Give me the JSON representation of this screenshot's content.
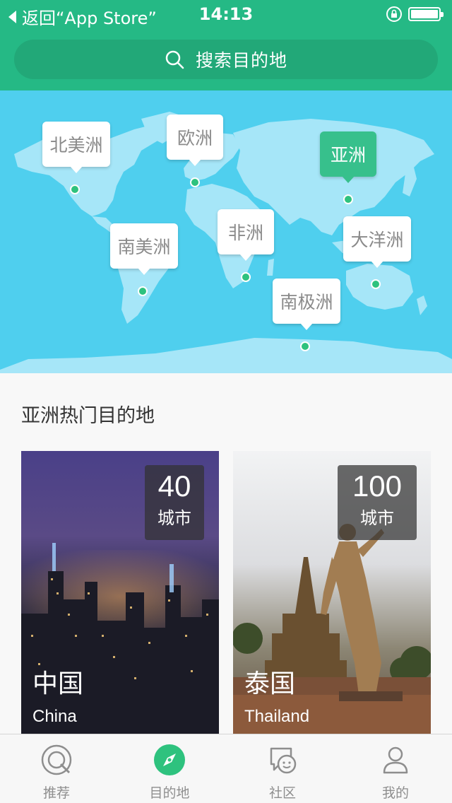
{
  "status_bar": {
    "back_label": "返回“App Store”",
    "time": "14:13"
  },
  "search": {
    "placeholder": "搜索目的地"
  },
  "map": {
    "regions": [
      {
        "id": "north-america",
        "label": "北美洲",
        "active": false
      },
      {
        "id": "europe",
        "label": "欧洲",
        "active": false
      },
      {
        "id": "asia",
        "label": "亚洲",
        "active": true
      },
      {
        "id": "south-america",
        "label": "南美洲",
        "active": false
      },
      {
        "id": "africa",
        "label": "非洲",
        "active": false
      },
      {
        "id": "oceania",
        "label": "大洋洲",
        "active": false
      },
      {
        "id": "antarctica",
        "label": "南极洲",
        "active": false
      }
    ]
  },
  "section": {
    "title": "亚洲热门目的地"
  },
  "destinations": [
    {
      "name": "中国",
      "name_en": "China",
      "count": "40",
      "unit": "城市"
    },
    {
      "name": "泰国",
      "name_en": "Thailand",
      "count": "100",
      "unit": "城市"
    }
  ],
  "tabs": [
    {
      "label": "推荐",
      "icon": "recommend-icon"
    },
    {
      "label": "目的地",
      "icon": "compass-icon",
      "active": true
    },
    {
      "label": "社区",
      "icon": "chat-icon"
    },
    {
      "label": "我的",
      "icon": "user-icon"
    }
  ],
  "colors": {
    "brand": "#25b985",
    "map_ocean": "#4fcfee",
    "active_pin": "#37c08c"
  }
}
